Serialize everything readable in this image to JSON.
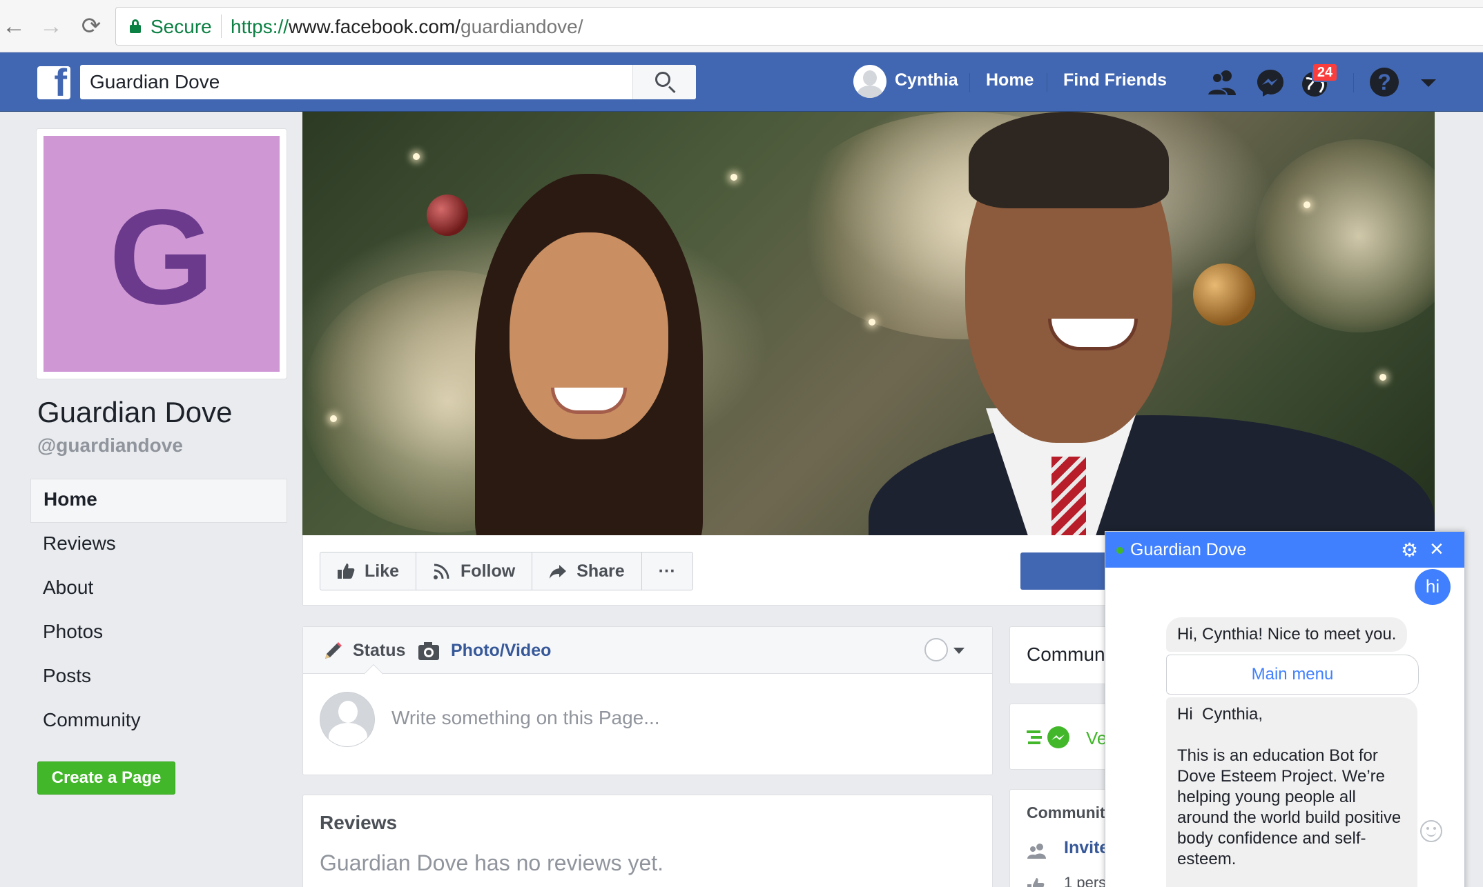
{
  "browser": {
    "back_glyph": "←",
    "forward_glyph": "→",
    "reload_glyph": "⟳",
    "secure_label": "Secure",
    "url_protocol": "https://",
    "url_host": "www.facebook.com/",
    "url_path": "guardiandove/"
  },
  "topbar": {
    "logo_letter": "f",
    "search_value": "Guardian Dove",
    "user_name": "Cynthia",
    "home_label": "Home",
    "find_friends_label": "Find Friends",
    "notifications_count": "24",
    "help_glyph": "?",
    "brand_color": "#4267b2"
  },
  "page": {
    "initial": "G",
    "name": "Guardian Dove",
    "handle": "@guardiandove",
    "profile_bg": "#cf98d5",
    "initial_color": "#6b3a8c"
  },
  "left_nav": {
    "items": [
      "Home",
      "Reviews",
      "About",
      "Photos",
      "Posts",
      "Community"
    ],
    "create_page_label": "Create a Page"
  },
  "actions": {
    "like_label": "Like",
    "follow_label": "Follow",
    "share_label": "Share",
    "more_label": "···"
  },
  "composer": {
    "status_label": "Status",
    "photo_video_label": "Photo/Video",
    "placeholder": "Write something on this Page..."
  },
  "reviews": {
    "title": "Reviews",
    "empty_text": "Guardian Dove has no reviews yet."
  },
  "right_column": {
    "community_title_partial": "Commun",
    "messenger_text_partial": "Ve",
    "community_heading_partial": "Community",
    "invite_partial": "Invite",
    "footer_partial": "1 pers"
  },
  "chat": {
    "title": "Guardian Dove",
    "my_message": "hi",
    "bot_greeting": "Hi, Cynthia! Nice to meet you.",
    "quick_reply": "Main menu",
    "bot_intro": "Hi  Cynthia,",
    "bot_message": "This is an education Bot for Dove Esteem Project. We’re helping young people all around the world build positive body confidence and self-esteem.",
    "accent_color": "#4080ff"
  }
}
